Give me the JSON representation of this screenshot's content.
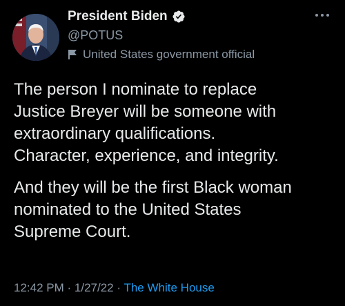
{
  "author": {
    "display_name": "President Biden",
    "handle": "@POTUS",
    "label": "United States government official"
  },
  "tweet": {
    "paragraphs": [
      {
        "lines": [
          "The person I nominate to replace",
          "Justice Breyer will be someone with",
          "extraordinary qualifications.",
          "Character, experience, and integrity."
        ]
      },
      {
        "lines": [
          "And they will be the first Black woman",
          "nominated to the United States",
          "Supreme Court."
        ]
      }
    ]
  },
  "meta": {
    "time": "12:42 PM",
    "separator": "·",
    "date": "1/27/22",
    "source": "The White House"
  },
  "icons": {
    "verified": "verified-badge-icon",
    "label": "flag-icon",
    "more": "more-horizontal-icon"
  },
  "colors": {
    "background": "#000000",
    "text": "#e7e9ea",
    "secondary": "#8b98a5",
    "link": "#1d9bf0"
  }
}
